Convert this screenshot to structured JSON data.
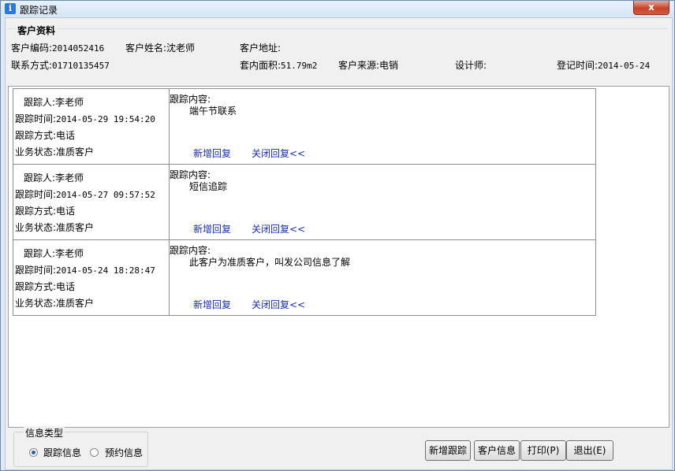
{
  "window": {
    "title": "跟踪记录",
    "close_glyph": "x"
  },
  "customer": {
    "group_title": "客户资料",
    "code_label": "客户编码:",
    "code_value": "2014052416",
    "name_label": "客户姓名:",
    "name_value": "沈老师",
    "address_label": "客户地址:",
    "contact_label": "联系方式:",
    "contact_value": "01710135457",
    "area_label": "套内面积:",
    "area_value": "51.79m2",
    "source_label": "客户来源:",
    "source_value": "电销",
    "designer_label": "设计师:",
    "regdate_label": "登记时间:",
    "regdate_value": "2014-05-24"
  },
  "records": [
    {
      "person_label": "跟踪人:",
      "person": "李老师",
      "time_label": "跟踪时间:",
      "time": "2014-05-29 19:54:20",
      "method_label": "跟踪方式:",
      "method": "电话",
      "status_label": "业务状态:",
      "status": "准质客户",
      "content_label": "跟踪内容:",
      "content": "端午节联系",
      "add_reply": "新增回复",
      "close_reply": "关闭回复<<"
    },
    {
      "person_label": "跟踪人:",
      "person": "李老师",
      "time_label": "跟踪时间:",
      "time": "2014-05-27 09:57:52",
      "method_label": "跟踪方式:",
      "method": "电话",
      "status_label": "业务状态:",
      "status": "准质客户",
      "content_label": "跟踪内容:",
      "content": "短信追踪",
      "add_reply": "新增回复",
      "close_reply": "关闭回复<<"
    },
    {
      "person_label": "跟踪人:",
      "person": "李老师",
      "time_label": "跟踪时间:",
      "time": "2014-05-24 18:28:47",
      "method_label": "跟踪方式:",
      "method": "电话",
      "status_label": "业务状态:",
      "status": "准质客户",
      "content_label": "跟踪内容:",
      "content": "此客户为准质客户，叫发公司信息了解",
      "add_reply": "新增回复",
      "close_reply": "关闭回复<<"
    }
  ],
  "info_type": {
    "legend": "信息类型",
    "options": [
      {
        "label": "跟踪信息",
        "checked": true
      },
      {
        "label": "预约信息",
        "checked": false
      }
    ]
  },
  "buttons": {
    "add_tracking": "新增跟踪",
    "customer_info": "客户信息",
    "print": "打印(P)",
    "exit": "退出(E)"
  }
}
